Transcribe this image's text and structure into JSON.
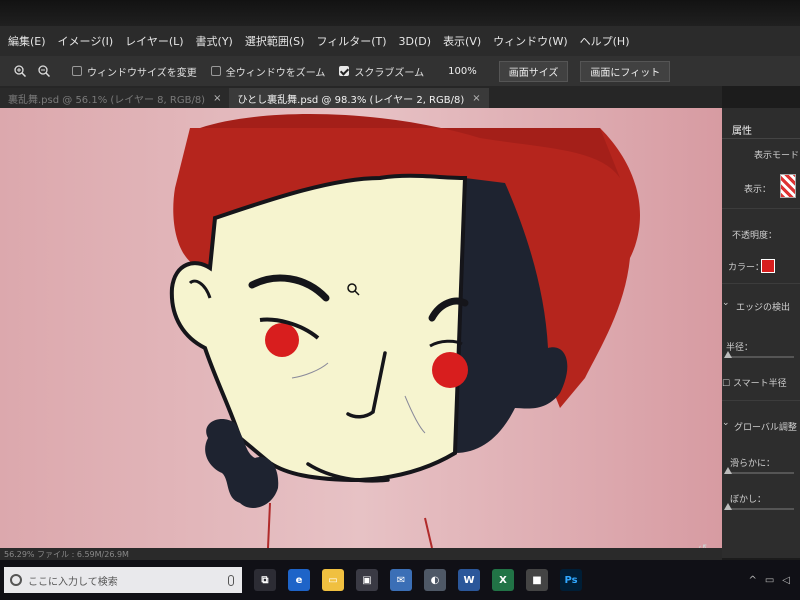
{
  "menu": [
    "編集(E)",
    "イメージ(I)",
    "レイヤー(L)",
    "書式(Y)",
    "選択範囲(S)",
    "フィルター(T)",
    "3D(D)",
    "表示(V)",
    "ウィンドウ(W)",
    "ヘルプ(H)"
  ],
  "options": {
    "resize_windows": "ウィンドウサイズを変更",
    "zoom_all": "全ウィンドウをズーム",
    "scrubby_zoom": "スクラブズーム",
    "zoom_pct": "100%",
    "fit_screen": "画面サイズ",
    "fill_screen": "画面にフィット"
  },
  "tabs": [
    {
      "label": "裏乱舞.psd @ 56.1% (レイヤー 8, RGB/8)",
      "close": "×"
    },
    {
      "label": "ひとし裏乱舞.psd @ 98.3% (レイヤー 2, RGB/8)",
      "close": "×"
    }
  ],
  "panel": {
    "tab": "属性",
    "display_mode": "表示モード",
    "display": "表示：",
    "opacity": "不透明度：",
    "color": "カラー：",
    "edge_detect": "エッジの検出",
    "radius": "半径：",
    "smart_radius": "スマート半径",
    "global_adjust": "グローバル調整",
    "smooth": "滑らかに：",
    "feather": "ぼかし："
  },
  "status": "56.29%     ファイル : 6.59M/26.9M",
  "taskbar": {
    "search_placeholder": "ここに入力して検索"
  },
  "colors": {
    "mask_red": "#d81e1e",
    "hair": "#b5251d",
    "skin": "#f6f4cf",
    "shadow": "#1e2330"
  }
}
